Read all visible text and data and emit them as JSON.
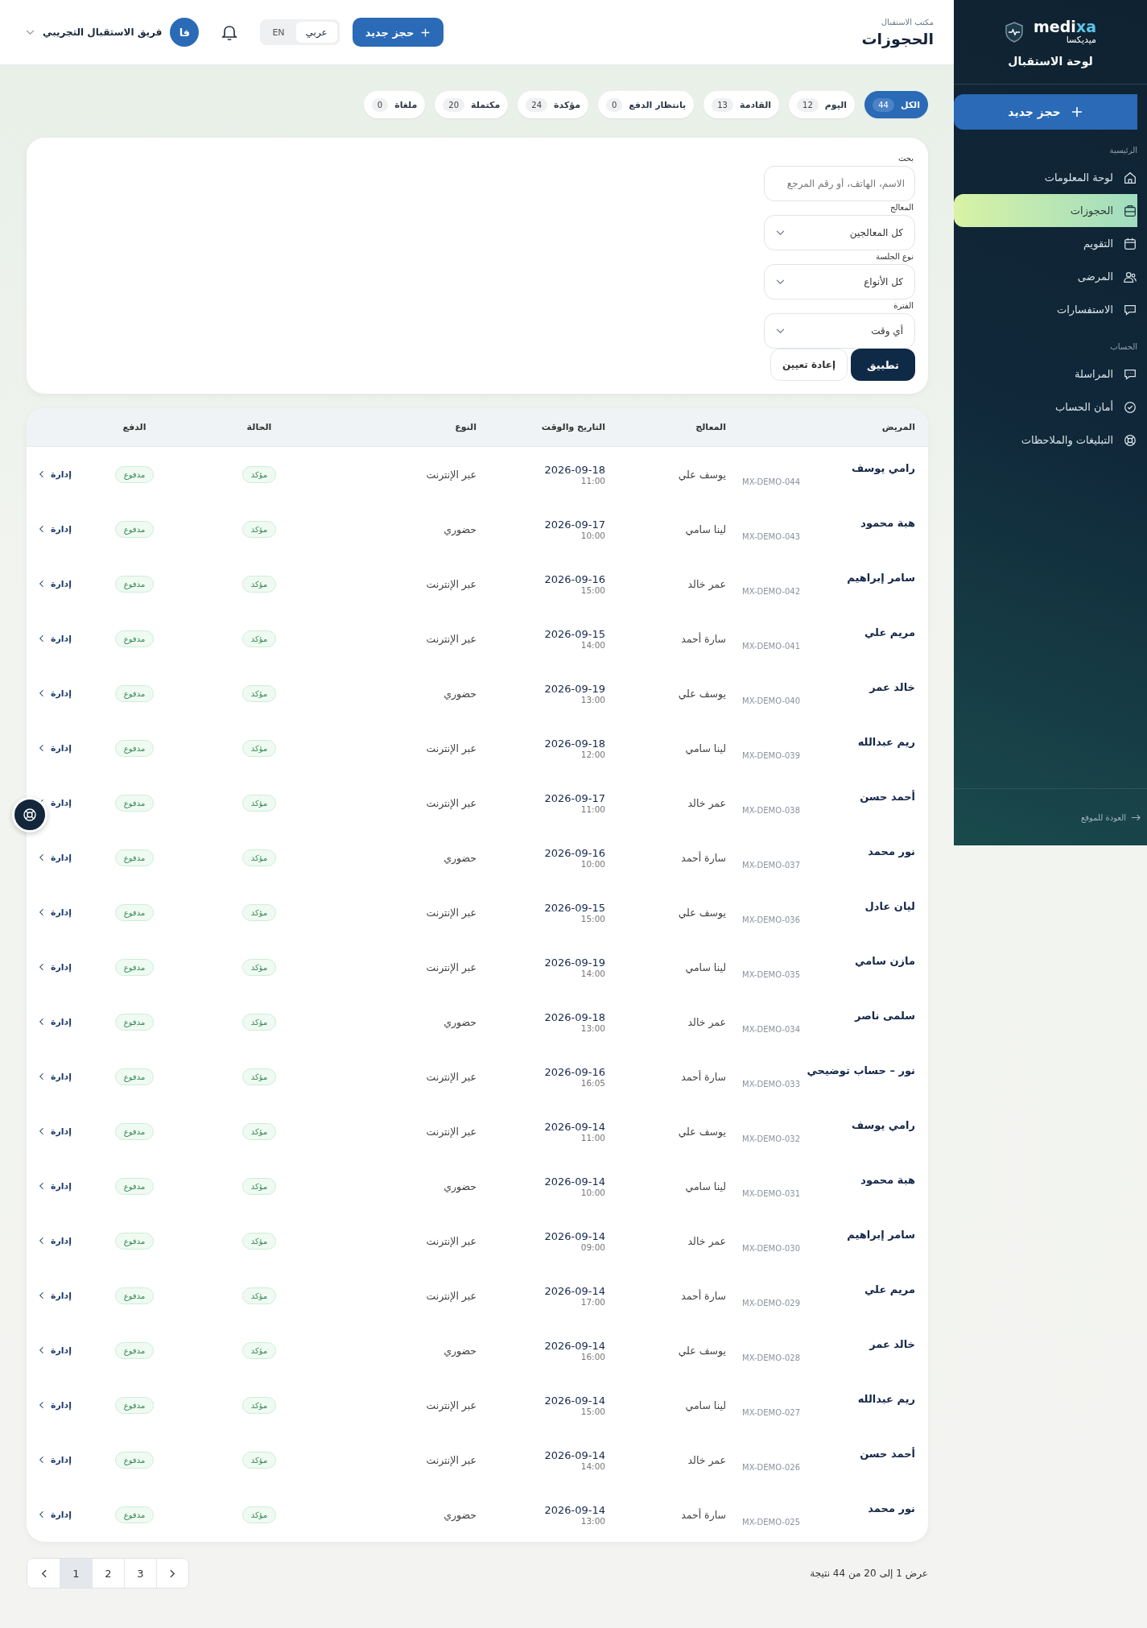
{
  "sidebar": {
    "brand": {
      "latin_main": "medi",
      "latin_accent": "xa",
      "arabic": "ميديكسا"
    },
    "title": "لوحة الاستقبال",
    "new_button": "حجز جديد",
    "sections": [
      {
        "label": "الرئيسية",
        "items": [
          {
            "label": "لوحة المعلومات",
            "kind": "home",
            "selected": false
          },
          {
            "label": "الحجوزات",
            "kind": "bookings",
            "selected": true
          },
          {
            "label": "التقويم",
            "kind": "calendar",
            "selected": false
          },
          {
            "label": "المرضى",
            "kind": "users",
            "selected": false
          },
          {
            "label": "الاستفسارات",
            "kind": "chat",
            "selected": false
          }
        ]
      },
      {
        "label": "الحساب",
        "items": [
          {
            "label": "المراسلة",
            "kind": "chat",
            "selected": false
          },
          {
            "label": "أمان الحساب",
            "kind": "shield",
            "selected": false
          },
          {
            "label": "التبليغات والملاحظات",
            "kind": "lifebuoy",
            "selected": false
          }
        ]
      }
    ],
    "back_link": "العودة للموقع"
  },
  "header": {
    "breadcrumb": "مكتب الاستقبال",
    "title": "الحجوزات",
    "new_button": "حجز جديد",
    "languages": [
      {
        "label": "عربي",
        "selected": true
      },
      {
        "label": "EN",
        "selected": false
      }
    ],
    "user": {
      "initials": "فا",
      "name": "فريق الاستقبال التجريبي"
    }
  },
  "status_tabs": [
    {
      "label": "الكل",
      "count": "44",
      "selected": true
    },
    {
      "label": "اليوم",
      "count": "12",
      "selected": false
    },
    {
      "label": "القادمة",
      "count": "13",
      "selected": false
    },
    {
      "label": "بانتظار الدفع",
      "count": "0",
      "selected": false
    },
    {
      "label": "مؤكدة",
      "count": "24",
      "selected": false
    },
    {
      "label": "مكتملة",
      "count": "20",
      "selected": false
    },
    {
      "label": "ملغاة",
      "count": "0",
      "selected": false
    }
  ],
  "filters": {
    "search": {
      "label": "بحث",
      "placeholder": "الاسم، الهاتف، أو رقم المرجع"
    },
    "selects": [
      {
        "label": "المعالج",
        "value": "كل المعالجين"
      },
      {
        "label": "نوع الجلسة",
        "value": "كل الأنواع"
      },
      {
        "label": "الفترة",
        "value": "أي وقت"
      }
    ],
    "apply": "تطبيق",
    "reset": "إعادة تعيين"
  },
  "table": {
    "columns": [
      "المريض",
      "المعالج",
      "التاريخ والوقت",
      "النوع",
      "الحالة",
      "الدفع"
    ],
    "rows": [
      {
        "patient": "رامي يوسف",
        "ref": "MX-DEMO-044",
        "therapist": "يوسف علي",
        "date": "2026-09-18",
        "time": "11:00",
        "type": "عبر الإنترنت",
        "status": "مؤكد",
        "payment": "مدفوع",
        "action": "إدارة"
      },
      {
        "patient": "هبة محمود",
        "ref": "MX-DEMO-043",
        "therapist": "لينا سامي",
        "date": "2026-09-17",
        "time": "10:00",
        "type": "حضوري",
        "status": "مؤكد",
        "payment": "مدفوع",
        "action": "إدارة"
      },
      {
        "patient": "سامر إبراهيم",
        "ref": "MX-DEMO-042",
        "therapist": "عمر خالد",
        "date": "2026-09-16",
        "time": "15:00",
        "type": "عبر الإنترنت",
        "status": "مؤكد",
        "payment": "مدفوع",
        "action": "إدارة"
      },
      {
        "patient": "مريم علي",
        "ref": "MX-DEMO-041",
        "therapist": "سارة أحمد",
        "date": "2026-09-15",
        "time": "14:00",
        "type": "عبر الإنترنت",
        "status": "مؤكد",
        "payment": "مدفوع",
        "action": "إدارة"
      },
      {
        "patient": "خالد عمر",
        "ref": "MX-DEMO-040",
        "therapist": "يوسف علي",
        "date": "2026-09-19",
        "time": "13:00",
        "type": "حضوري",
        "status": "مؤكد",
        "payment": "مدفوع",
        "action": "إدارة"
      },
      {
        "patient": "ريم عبدالله",
        "ref": "MX-DEMO-039",
        "therapist": "لينا سامي",
        "date": "2026-09-18",
        "time": "12:00",
        "type": "عبر الإنترنت",
        "status": "مؤكد",
        "payment": "مدفوع",
        "action": "إدارة"
      },
      {
        "patient": "أحمد حسن",
        "ref": "MX-DEMO-038",
        "therapist": "عمر خالد",
        "date": "2026-09-17",
        "time": "11:00",
        "type": "عبر الإنترنت",
        "status": "مؤكد",
        "payment": "مدفوع",
        "action": "إدارة"
      },
      {
        "patient": "نور محمد",
        "ref": "MX-DEMO-037",
        "therapist": "سارة أحمد",
        "date": "2026-09-16",
        "time": "10:00",
        "type": "حضوري",
        "status": "مؤكد",
        "payment": "مدفوع",
        "action": "إدارة"
      },
      {
        "patient": "ليان عادل",
        "ref": "MX-DEMO-036",
        "therapist": "يوسف علي",
        "date": "2026-09-15",
        "time": "15:00",
        "type": "عبر الإنترنت",
        "status": "مؤكد",
        "payment": "مدفوع",
        "action": "إدارة"
      },
      {
        "patient": "مازن سامي",
        "ref": "MX-DEMO-035",
        "therapist": "لينا سامي",
        "date": "2026-09-19",
        "time": "14:00",
        "type": "عبر الإنترنت",
        "status": "مؤكد",
        "payment": "مدفوع",
        "action": "إدارة"
      },
      {
        "patient": "سلمى ناصر",
        "ref": "MX-DEMO-034",
        "therapist": "عمر خالد",
        "date": "2026-09-18",
        "time": "13:00",
        "type": "حضوري",
        "status": "مؤكد",
        "payment": "مدفوع",
        "action": "إدارة"
      },
      {
        "patient": "نور – حساب توضيحي",
        "ref": "MX-DEMO-033",
        "therapist": "سارة أحمد",
        "date": "2026-09-16",
        "time": "16:05",
        "type": "عبر الإنترنت",
        "status": "مؤكد",
        "payment": "مدفوع",
        "action": "إدارة"
      },
      {
        "patient": "رامي يوسف",
        "ref": "MX-DEMO-032",
        "therapist": "يوسف علي",
        "date": "2026-09-14",
        "time": "11:00",
        "type": "عبر الإنترنت",
        "status": "مؤكد",
        "payment": "مدفوع",
        "action": "إدارة"
      },
      {
        "patient": "هبة محمود",
        "ref": "MX-DEMO-031",
        "therapist": "لينا سامي",
        "date": "2026-09-14",
        "time": "10:00",
        "type": "حضوري",
        "status": "مؤكد",
        "payment": "مدفوع",
        "action": "إدارة"
      },
      {
        "patient": "سامر إبراهيم",
        "ref": "MX-DEMO-030",
        "therapist": "عمر خالد",
        "date": "2026-09-14",
        "time": "09:00",
        "type": "عبر الإنترنت",
        "status": "مؤكد",
        "payment": "مدفوع",
        "action": "إدارة"
      },
      {
        "patient": "مريم علي",
        "ref": "MX-DEMO-029",
        "therapist": "سارة أحمد",
        "date": "2026-09-14",
        "time": "17:00",
        "type": "عبر الإنترنت",
        "status": "مؤكد",
        "payment": "مدفوع",
        "action": "إدارة"
      },
      {
        "patient": "خالد عمر",
        "ref": "MX-DEMO-028",
        "therapist": "يوسف علي",
        "date": "2026-09-14",
        "time": "16:00",
        "type": "حضوري",
        "status": "مؤكد",
        "payment": "مدفوع",
        "action": "إدارة"
      },
      {
        "patient": "ريم عبدالله",
        "ref": "MX-DEMO-027",
        "therapist": "لينا سامي",
        "date": "2026-09-14",
        "time": "15:00",
        "type": "عبر الإنترنت",
        "status": "مؤكد",
        "payment": "مدفوع",
        "action": "إدارة"
      },
      {
        "patient": "أحمد حسن",
        "ref": "MX-DEMO-026",
        "therapist": "عمر خالد",
        "date": "2026-09-14",
        "time": "14:00",
        "type": "عبر الإنترنت",
        "status": "مؤكد",
        "payment": "مدفوع",
        "action": "إدارة"
      },
      {
        "patient": "نور محمد",
        "ref": "MX-DEMO-025",
        "therapist": "سارة أحمد",
        "date": "2026-09-14",
        "time": "13:00",
        "type": "حضوري",
        "status": "مؤكد",
        "payment": "مدفوع",
        "action": "إدارة"
      }
    ]
  },
  "pagination": {
    "summary": "عرض 1 إلى 20 من 44 نتيجة",
    "pages": [
      {
        "label": "3",
        "selected": false
      },
      {
        "label": "2",
        "selected": false
      },
      {
        "label": "1",
        "selected": true
      }
    ]
  }
}
